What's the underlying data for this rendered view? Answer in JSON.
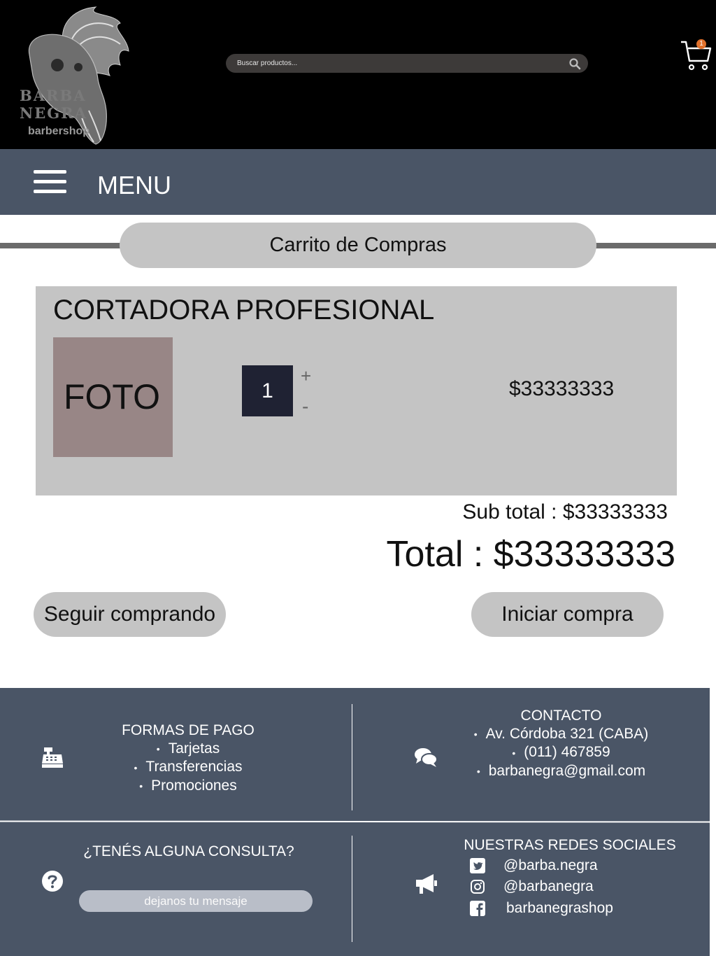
{
  "header": {
    "logo": {
      "line1": "BARBA",
      "line2": "NEGRA",
      "sub": "barbershop"
    },
    "search": {
      "placeholder": "Buscar productos..."
    },
    "cart": {
      "count": "1"
    }
  },
  "nav": {
    "menu_label": "MENU"
  },
  "page": {
    "title": "Carrito de Compras"
  },
  "cart_item": {
    "name": "CORTADORA PROFESIONAL",
    "photo_label": "FOTO",
    "quantity": "1",
    "increment_label": "+",
    "decrement_label": "-",
    "price": "$33333333"
  },
  "summary": {
    "subtotal": "Sub total : $33333333",
    "total": "Total : $33333333"
  },
  "actions": {
    "continue_label": "Seguir comprando",
    "checkout_label": "Iniciar compra"
  },
  "footer": {
    "payment": {
      "title": "FORMAS DE PAGO",
      "items": [
        "Tarjetas",
        "Transferencias",
        "Promociones"
      ]
    },
    "contact": {
      "title": "CONTACTO",
      "items": [
        "Av. Córdoba 321 (CABA)",
        "(011) 467859",
        "barbanegra@gmail.com"
      ]
    },
    "inquiry": {
      "title": "¿TENÉS ALGUNA CONSULTA?",
      "placeholder": "dejanos tu mensaje"
    },
    "social": {
      "title": "NUESTRAS REDES SOCIALES",
      "twitter": "@barba.negra",
      "instagram": "@barbanegra",
      "facebook": "barbanegrashop"
    }
  },
  "colors": {
    "header_bg": "#000000",
    "nav_bg": "#4a5566",
    "pill_bg": "#c4c4c4",
    "photo_bg": "#988686",
    "qty_bg": "#1f2233",
    "badge": "#e0702b"
  }
}
